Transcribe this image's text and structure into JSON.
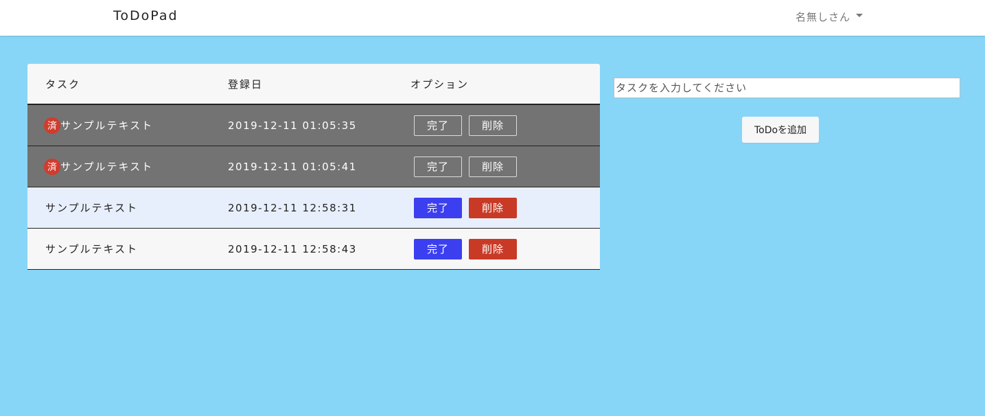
{
  "navbar": {
    "brand": "ToDoPad",
    "user_name": "名無しさん"
  },
  "table": {
    "headers": {
      "task": "タスク",
      "date": "登録日",
      "options": "オプション"
    },
    "rows": [
      {
        "done_badge": "済",
        "task": "サンプルテキスト",
        "date": "2019-12-11 01:05:35",
        "complete_label": "完了",
        "delete_label": "削除"
      },
      {
        "done_badge": "済",
        "task": "サンプルテキスト",
        "date": "2019-12-11 01:05:41",
        "complete_label": "完了",
        "delete_label": "削除"
      },
      {
        "task": "サンプルテキスト",
        "date": "2019-12-11 12:58:31",
        "complete_label": "完了",
        "delete_label": "削除"
      },
      {
        "task": "サンプルテキスト",
        "date": "2019-12-11 12:58:43",
        "complete_label": "完了",
        "delete_label": "削除"
      }
    ]
  },
  "form": {
    "placeholder": "タスクを入力してください",
    "value": "",
    "add_label": "ToDoを追加"
  },
  "colors": {
    "background": "#87d6f8",
    "done_row": "#737373",
    "complete_button": "#3c3ff0",
    "delete_button": "#c83a26",
    "done_badge": "#d03c2d"
  }
}
